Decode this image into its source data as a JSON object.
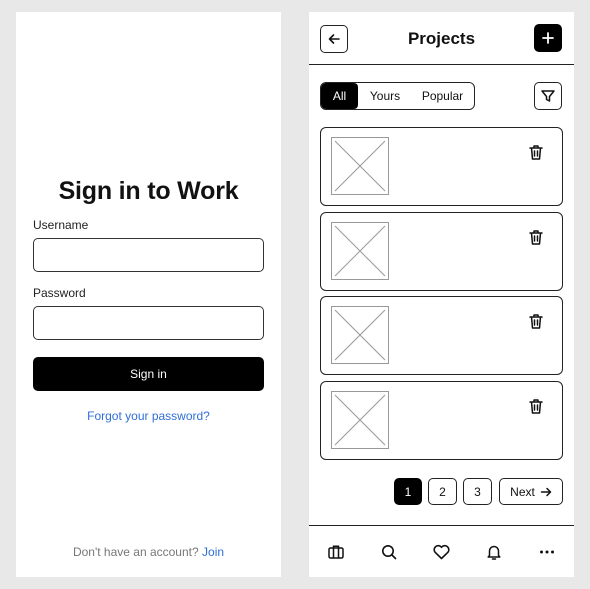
{
  "login": {
    "title": "Sign in to Work",
    "username_label": "Username",
    "username_value": "",
    "password_label": "Password",
    "password_value": "",
    "signin_label": "Sign in",
    "forgot_label": "Forgot your password?",
    "no_account_text": "Don't have an account?",
    "join_label": "Join"
  },
  "projects": {
    "title": "Projects",
    "back_icon": "arrow-left-icon",
    "add_icon": "plus-icon",
    "filter_icon": "filter-icon",
    "tabs": [
      {
        "label": "All",
        "active": true
      },
      {
        "label": "Yours",
        "active": false
      },
      {
        "label": "Popular",
        "active": false
      }
    ],
    "cards": [
      {
        "thumb_icon": "image-placeholder-icon",
        "action_icon": "trash-icon"
      },
      {
        "thumb_icon": "image-placeholder-icon",
        "action_icon": "trash-icon"
      },
      {
        "thumb_icon": "image-placeholder-icon",
        "action_icon": "trash-icon"
      },
      {
        "thumb_icon": "image-placeholder-icon",
        "action_icon": "trash-icon"
      }
    ],
    "pagination": {
      "pages": [
        "1",
        "2",
        "3"
      ],
      "current": "1",
      "next_label": "Next",
      "next_icon": "arrow-right-icon"
    },
    "bottom_nav": [
      "briefcase-icon",
      "search-icon",
      "heart-icon",
      "bell-icon",
      "more-icon"
    ]
  },
  "colors": {
    "primary": "#000000",
    "link": "#2f6fd6",
    "background": "#e8e8e8",
    "surface": "#ffffff"
  }
}
